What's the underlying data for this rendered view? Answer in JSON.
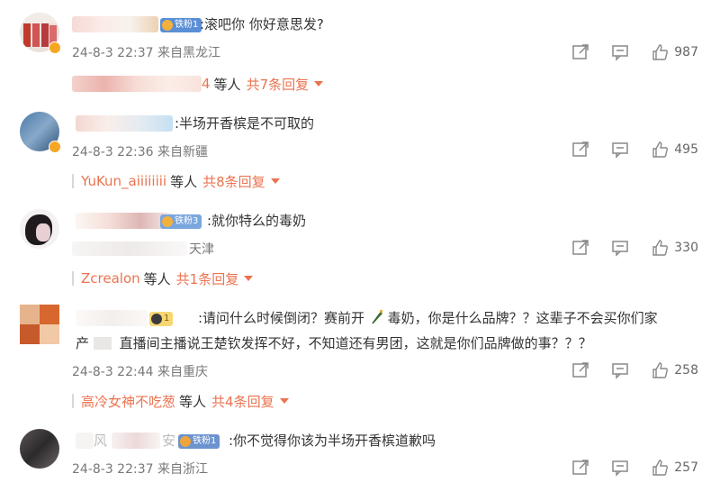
{
  "comments": [
    {
      "text": ":滚吧你 你好意思发?",
      "badge": "铁粉1",
      "time": "24-8-3 22:37",
      "location": "来自黑龙江",
      "likes": "987",
      "reply_who": "4",
      "reply_mid": "等人",
      "reply_count": "共7条回复"
    },
    {
      "text": ":半场开香槟是不可取的",
      "time": "24-8-3 22:36",
      "location": "来自新疆",
      "likes": "495",
      "reply_who": "YuKun_aiiiiiiii",
      "reply_mid": "等人",
      "reply_count": "共8条回复"
    },
    {
      "text": ":就你特么的毒奶",
      "badge": "铁粉3",
      "location": "天津",
      "likes": "330",
      "reply_who": "Zcrealon",
      "reply_mid": "等人",
      "reply_count": "共1条回复"
    },
    {
      "text_line1": ":请问什么时候倒闭？赛前开",
      "text_line1b": "毒奶，你是什么品牌？？这辈子不会买你们家",
      "text_line2a": "产",
      "text_line2": "直播间主播说王楚钦发挥不好，不知道还有男团，这就是你们品牌做的事？？？",
      "time": "24-8-3 22:44",
      "location": "来自重庆",
      "likes": "258",
      "reply_who": "高冷女神不吃葱",
      "reply_mid": "等人",
      "reply_count": "共4条回复"
    },
    {
      "text": ":你不觉得你该为半场开香槟道歉吗",
      "badge": "铁粉1",
      "name_fragment": "风",
      "name_fragment2": "安",
      "time": "24-8-3 22:37",
      "location": "来自浙江",
      "likes": "257"
    }
  ],
  "icons": {
    "share": "share-icon",
    "comment": "comment-icon",
    "like": "like-icon",
    "expand": "caret-down-icon"
  },
  "colors": {
    "accent": "#eb7350",
    "meta": "#777777",
    "badge": "#5a8fd6"
  }
}
